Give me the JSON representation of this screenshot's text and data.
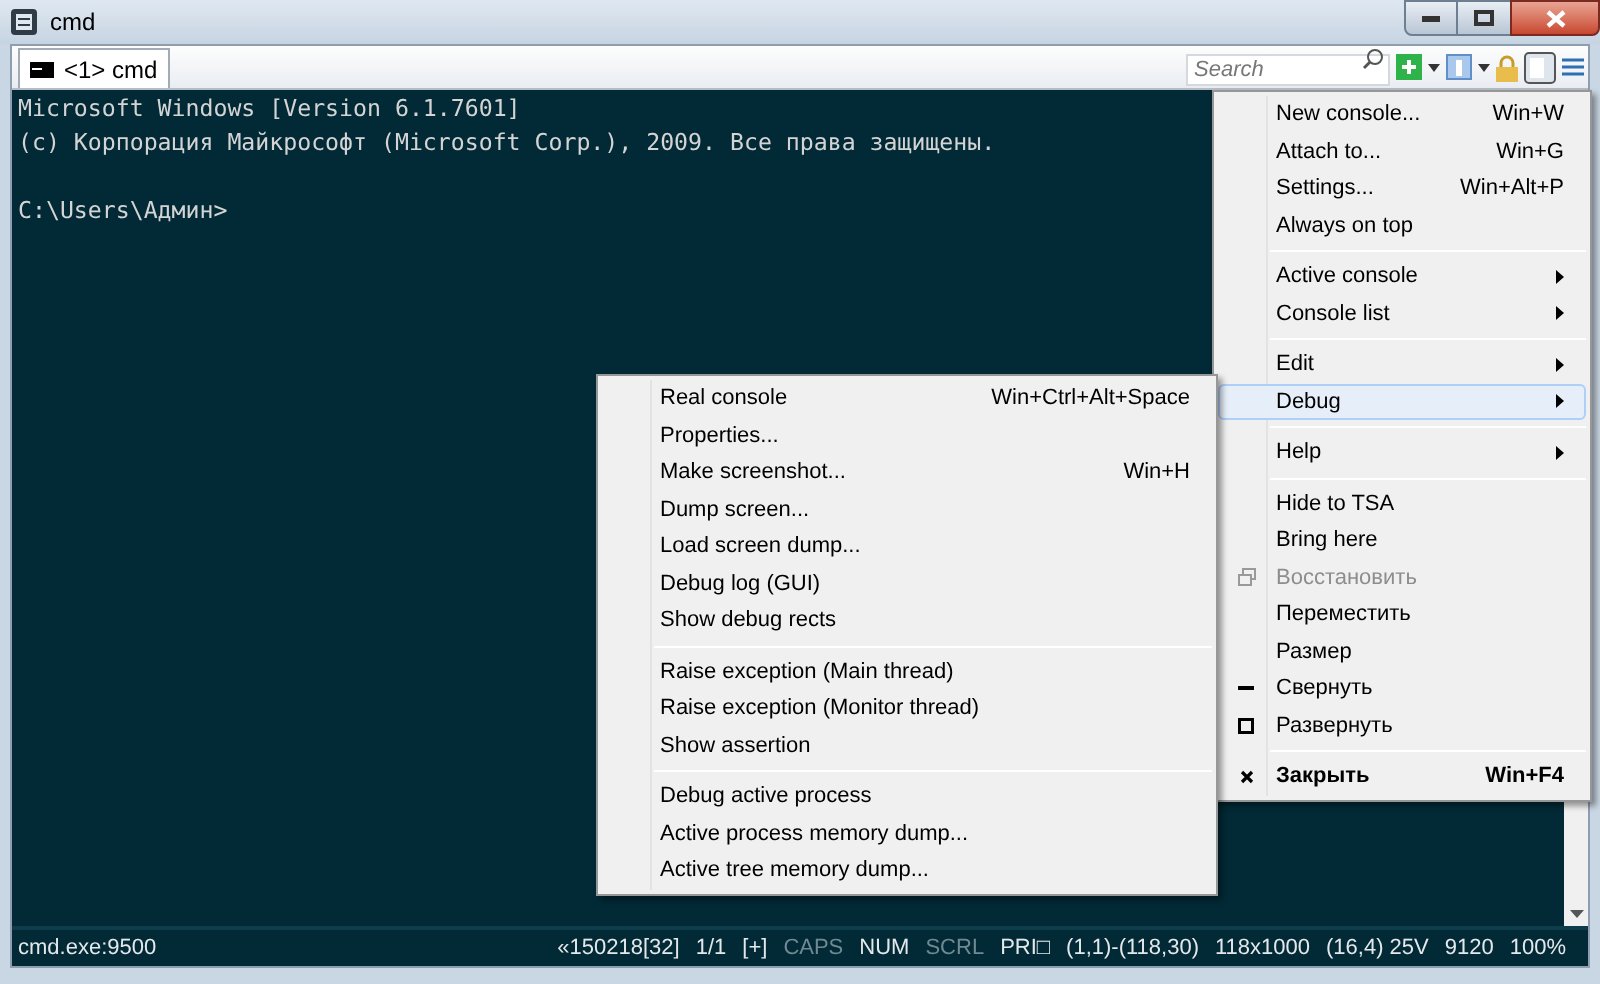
{
  "window": {
    "title": "cmd"
  },
  "tabs": [
    {
      "label": "<1> cmd",
      "selected": true
    }
  ],
  "search": {
    "placeholder": "Search"
  },
  "console": {
    "lines": [
      "Microsoft Windows [Version 6.1.7601]",
      "(c) Корпорация Майкрософт (Microsoft Corp.), 2009. Все права защищены."
    ],
    "prompt": "C:\\Users\\Админ>"
  },
  "main_menu": [
    {
      "kind": "item",
      "label": "New console...",
      "shortcut": "Win+W"
    },
    {
      "kind": "item",
      "label": "Attach to...",
      "shortcut": "Win+G"
    },
    {
      "kind": "item",
      "label": "Settings...",
      "shortcut": "Win+Alt+P"
    },
    {
      "kind": "item",
      "label": "Always on top"
    },
    {
      "kind": "separator"
    },
    {
      "kind": "item",
      "label": "Active console",
      "submenu": true
    },
    {
      "kind": "item",
      "label": "Console list",
      "submenu": true
    },
    {
      "kind": "separator"
    },
    {
      "kind": "item",
      "label": "Edit",
      "submenu": true
    },
    {
      "kind": "item",
      "label": "Debug",
      "submenu": true,
      "selected": true
    },
    {
      "kind": "separator"
    },
    {
      "kind": "item",
      "label": "Help",
      "submenu": true
    },
    {
      "kind": "separator"
    },
    {
      "kind": "item",
      "label": "Hide to TSA"
    },
    {
      "kind": "item",
      "label": "Bring here"
    },
    {
      "kind": "restore",
      "label": "Восстановить",
      "disabled": true
    },
    {
      "kind": "item",
      "label": "Переместить"
    },
    {
      "kind": "item",
      "label": "Размер"
    },
    {
      "kind": "minimize",
      "label": "Свернуть"
    },
    {
      "kind": "maximize",
      "label": "Развернуть"
    },
    {
      "kind": "separator"
    },
    {
      "kind": "close",
      "label": "Закрыть",
      "shortcut": "Win+F4",
      "bold": true
    }
  ],
  "debug_menu": [
    {
      "kind": "item",
      "label": "Real console",
      "shortcut": "Win+Ctrl+Alt+Space"
    },
    {
      "kind": "item",
      "label": "Properties..."
    },
    {
      "kind": "item",
      "label": "Make screenshot...",
      "shortcut": "Win+H"
    },
    {
      "kind": "item",
      "label": "Dump screen..."
    },
    {
      "kind": "item",
      "label": "Load screen dump..."
    },
    {
      "kind": "item",
      "label": "Debug log (GUI)"
    },
    {
      "kind": "item",
      "label": "Show debug rects"
    },
    {
      "kind": "separator"
    },
    {
      "kind": "item",
      "label": "Raise exception (Main thread)"
    },
    {
      "kind": "item",
      "label": "Raise exception (Monitor thread)"
    },
    {
      "kind": "item",
      "label": "Show assertion"
    },
    {
      "kind": "separator"
    },
    {
      "kind": "item",
      "label": "Debug active process"
    },
    {
      "kind": "item",
      "label": "Active process memory dump..."
    },
    {
      "kind": "item",
      "label": "Active tree memory dump..."
    }
  ],
  "status_bar": {
    "process": "cmd.exe:9500",
    "items": [
      {
        "text": "«150218[32]",
        "on": true
      },
      {
        "text": "1/1",
        "on": true
      },
      {
        "text": "[+]",
        "on": true
      },
      {
        "text": "CAPS",
        "on": false
      },
      {
        "text": "NUM",
        "on": true
      },
      {
        "text": "SCRL",
        "on": false
      },
      {
        "text": "PRI□",
        "on": true
      },
      {
        "text": "(1,1)-(118,30)",
        "on": true
      },
      {
        "text": "118x1000",
        "on": true
      },
      {
        "text": "(16,4) 25V",
        "on": true
      },
      {
        "text": "9120",
        "on": true
      },
      {
        "text": "100%",
        "on": true
      }
    ]
  }
}
